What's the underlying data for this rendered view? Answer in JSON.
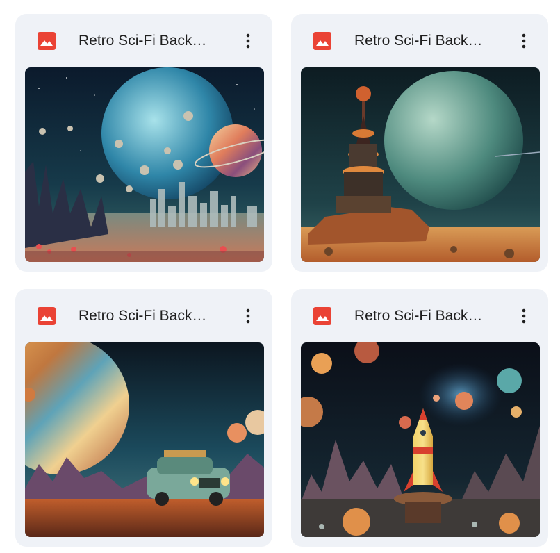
{
  "files": [
    {
      "title": "Retro Sci-Fi Back…",
      "file_type_icon": "image-file-icon",
      "menu_icon": "more-vert-icon"
    },
    {
      "title": "Retro Sci-Fi Back…",
      "file_type_icon": "image-file-icon",
      "menu_icon": "more-vert-icon"
    },
    {
      "title": "Retro Sci-Fi Back…",
      "file_type_icon": "image-file-icon",
      "menu_icon": "more-vert-icon"
    },
    {
      "title": "Retro Sci-Fi Back…",
      "file_type_icon": "image-file-icon",
      "menu_icon": "more-vert-icon"
    }
  ],
  "colors": {
    "card_bg": "#eff2f7",
    "image_icon_red": "#ea4335",
    "text": "#1f1f1f"
  }
}
